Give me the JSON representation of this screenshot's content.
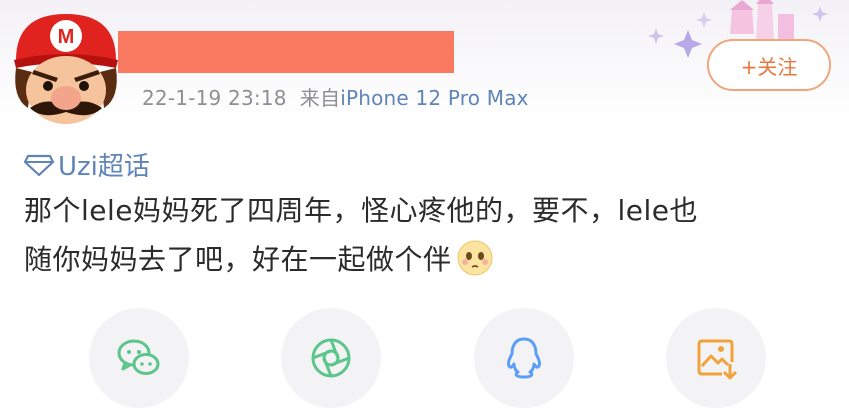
{
  "post": {
    "avatar_icon": "mario-avatar-icon",
    "timestamp": "22-1-19 23:18",
    "source_prefix": "来自",
    "source_device": "iPhone 12 Pro Max",
    "follow_label": "+关注",
    "topic_label": "Uzi超话",
    "text_line1": "那个lele妈妈死了四周年，怪心疼他的，要不，lele也",
    "text_line2": "随你妈妈去了吧，好在一起做个伴"
  },
  "share_bar": {
    "items": [
      {
        "icon": "wechat-icon",
        "color": "#5cc58a"
      },
      {
        "icon": "moments-aperture-icon",
        "color": "#5cc58a"
      },
      {
        "icon": "qq-penguin-icon",
        "color": "#5a9ef5"
      },
      {
        "icon": "save-image-icon",
        "color": "#f0a33a"
      }
    ]
  },
  "colors": {
    "redaction": "#f97a60",
    "link_blue": "#5f85b8",
    "follow_orange": "#e8763c"
  }
}
